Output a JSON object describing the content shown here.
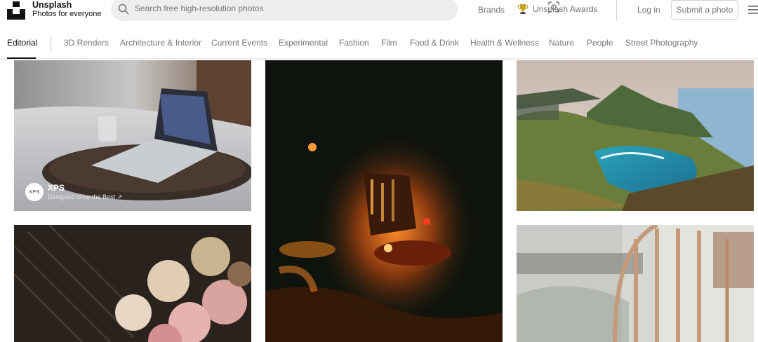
{
  "brand": {
    "name": "Unsplash",
    "tagline": "Photos for everyone"
  },
  "search": {
    "placeholder": "Search free high-resolution photos",
    "value": ""
  },
  "header_nav": {
    "brands_label": "Brands",
    "awards_label": "Unsplash Awards",
    "login_label": "Log in",
    "submit_label": "Submit a photo"
  },
  "topics": [
    {
      "label": "Editorial",
      "active": true
    },
    {
      "label": "3D Renders"
    },
    {
      "label": "Architecture & Interior"
    },
    {
      "label": "Current Events"
    },
    {
      "label": "Experimental"
    },
    {
      "label": "Fashion"
    },
    {
      "label": "Film"
    },
    {
      "label": "Food & Drink"
    },
    {
      "label": "Health & Wellness"
    },
    {
      "label": "Nature"
    },
    {
      "label": "People"
    },
    {
      "label": "Street Photography"
    }
  ],
  "photos": {
    "laptop": {
      "sponsor_name": "XPS",
      "sponsor_tagline": "Designed to be the Best ↗",
      "avatar_text": "XPS"
    }
  },
  "icons": {
    "logo": "unsplash-logo",
    "search": "search-icon",
    "visual_search": "visual-search-icon",
    "trophy": "trophy-icon",
    "menu": "hamburger-menu-icon"
  },
  "colors": {
    "accent": "#111111",
    "muted_text": "#767676",
    "search_bg": "#eeeeee",
    "trophy": "#c9a227"
  }
}
